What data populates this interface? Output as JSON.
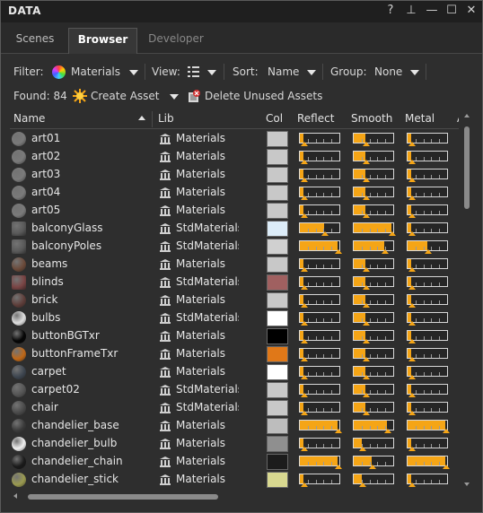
{
  "window": {
    "title": "DATA",
    "help": "?",
    "pin": "⊥",
    "minimize": "—",
    "maximize": "☐",
    "close": "✕"
  },
  "tabs": [
    {
      "label": "Scenes"
    },
    {
      "label": "Browser"
    },
    {
      "label": "Developer"
    }
  ],
  "toolbar": {
    "filter_label": "Filter:",
    "filter_value": "Materials",
    "view_label": "View:",
    "sort_label": "Sort:",
    "sort_value": "Name",
    "group_label": "Group:",
    "group_value": "None"
  },
  "actions": {
    "found": "Found: 84",
    "create_asset": "Create Asset",
    "delete_unused": "Delete Unused Assets"
  },
  "columns": {
    "name": "Name",
    "lib": "Lib",
    "col": "Col",
    "reflect": "Reflect",
    "smooth": "Smooth",
    "metal": "Metal",
    "next": "A"
  },
  "colors": {
    "accent": "#f5a516",
    "bg": "#2e2e2e"
  },
  "rows": [
    {
      "name": "art01",
      "lib": "Materials",
      "ball": "#7a7a7a",
      "color": "#c8c8c8",
      "reflect": 0.08,
      "smooth": 0.3,
      "metal": 0.08
    },
    {
      "name": "art02",
      "lib": "Materials",
      "ball": "#7a7a7a",
      "color": "#c8c8c8",
      "reflect": 0.08,
      "smooth": 0.3,
      "metal": 0.08
    },
    {
      "name": "art03",
      "lib": "Materials",
      "ball": "#7a7a7a",
      "color": "#c8c8c8",
      "reflect": 0.08,
      "smooth": 0.3,
      "metal": 0.08
    },
    {
      "name": "art04",
      "lib": "Materials",
      "ball": "#7a7a7a",
      "color": "#c8c8c8",
      "reflect": 0.08,
      "smooth": 0.3,
      "metal": 0.08
    },
    {
      "name": "art05",
      "lib": "Materials",
      "ball": "#7a7a7a",
      "color": "#c8c8c8",
      "reflect": 0.08,
      "smooth": 0.3,
      "metal": 0.08
    },
    {
      "name": "balconyGlass",
      "lib": "StdMaterials",
      "ball": "#5a5a5a",
      "color": "#dcecf8",
      "reflect": 0.62,
      "smooth": 0.95,
      "metal": 0.08
    },
    {
      "name": "balconyPoles",
      "lib": "StdMaterials",
      "ball": "#5a5a5a",
      "color": "#d0d0d0",
      "reflect": 0.95,
      "smooth": 0.78,
      "metal": 0.5
    },
    {
      "name": "beams",
      "lib": "Materials",
      "ball": "#6b4a3a",
      "color": "#c8c8c8",
      "reflect": 0.08,
      "smooth": 0.3,
      "metal": 0.08
    },
    {
      "name": "blinds",
      "lib": "StdMaterials",
      "ball": "#7a4545",
      "color": "#a06060",
      "reflect": 0.08,
      "smooth": 0.3,
      "metal": 0.08
    },
    {
      "name": "brick",
      "lib": "Materials",
      "ball": "#5e3e3a",
      "color": "#c8c8c8",
      "reflect": 0.08,
      "smooth": 0.3,
      "metal": 0.08
    },
    {
      "name": "bulbs",
      "lib": "StdMaterials",
      "ball": "#e0e0e0",
      "color": "#ffffff",
      "reflect": 0.08,
      "smooth": 0.3,
      "metal": 0.08
    },
    {
      "name": "buttonBGTxr",
      "lib": "Materials",
      "ball": "#050505",
      "color": "#000000",
      "reflect": 0.08,
      "smooth": 0.3,
      "metal": 0.08
    },
    {
      "name": "buttonFrameTxr",
      "lib": "Materials",
      "ball": "#c06818",
      "color": "#e07818",
      "reflect": 0.08,
      "smooth": 0.3,
      "metal": 0.08
    },
    {
      "name": "carpet",
      "lib": "Materials",
      "ball": "#3e4650",
      "color": "#ffffff",
      "reflect": 0.08,
      "smooth": 0.3,
      "metal": 0.08
    },
    {
      "name": "carpet02",
      "lib": "StdMaterials",
      "ball": "#555555",
      "color": "#c8c8c8",
      "reflect": 0.08,
      "smooth": 0.3,
      "metal": 0.08
    },
    {
      "name": "chair",
      "lib": "StdMaterials",
      "ball": "#4a4a4a",
      "color": "#c8c8c8",
      "reflect": 0.08,
      "smooth": 0.3,
      "metal": 0.08
    },
    {
      "name": "chandelier_base",
      "lib": "Materials",
      "ball": "#3a3a3a",
      "color": "#bdbdbd",
      "reflect": 0.95,
      "smooth": 0.85,
      "metal": 0.95
    },
    {
      "name": "chandelier_bulb",
      "lib": "Materials",
      "ball": "#f0f0f0",
      "color": "#8f8f8f",
      "reflect": 0.08,
      "smooth": 0.2,
      "metal": 0.08
    },
    {
      "name": "chandelier_chain",
      "lib": "Materials",
      "ball": "#1a1a1a",
      "color": "#1c1c1c",
      "reflect": 0.95,
      "smooth": 0.45,
      "metal": 0.95
    },
    {
      "name": "chandelier_stick",
      "lib": "Materials",
      "ball": "#9a9a50",
      "color": "#d8d890",
      "reflect": 0.08,
      "smooth": 0.2,
      "metal": 0.08
    }
  ]
}
